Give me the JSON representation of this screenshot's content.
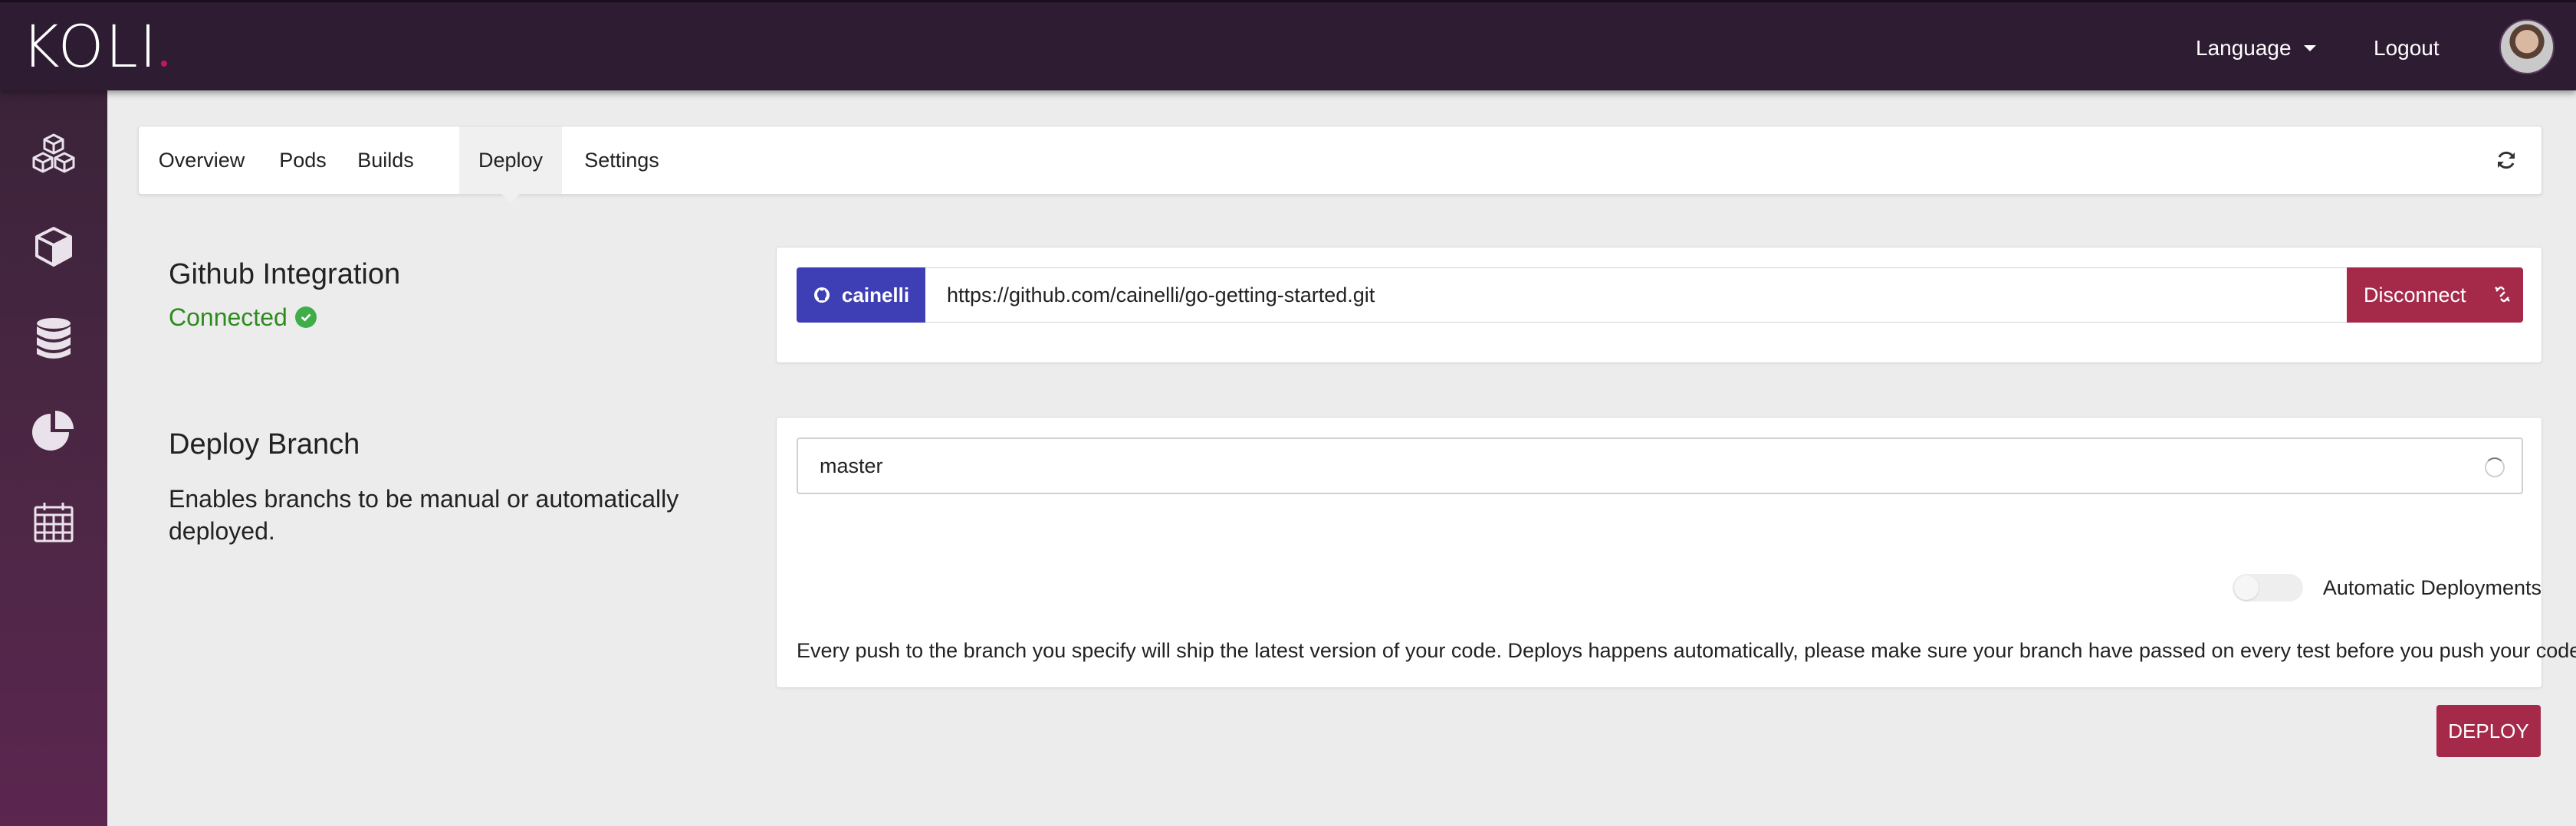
{
  "header": {
    "logo": "KOLI",
    "language_label": "Language",
    "logout_label": "Logout"
  },
  "sidebar": {
    "items": [
      {
        "icon": "cubes-icon"
      },
      {
        "icon": "cube-icon"
      },
      {
        "icon": "database-icon"
      },
      {
        "icon": "pie-chart-icon"
      },
      {
        "icon": "calendar-icon"
      }
    ]
  },
  "tabs": [
    {
      "label": "Overview"
    },
    {
      "label": "Pods"
    },
    {
      "label": "Builds"
    },
    {
      "label": "Deploy",
      "active": true
    },
    {
      "label": "Settings"
    }
  ],
  "github": {
    "title": "Github Integration",
    "status": "Connected",
    "user": "cainelli",
    "repo_url": "https://github.com/cainelli/go-getting-started.git",
    "disconnect_label": "Disconnect"
  },
  "deploy_branch": {
    "title": "Deploy Branch",
    "description": "Enables branchs to be manual or automatically deployed.",
    "branch_value": "master",
    "auto_label": "Automatic Deployments",
    "auto_enabled": false,
    "note": "Every push to the branch you specify will ship the latest version of your code. Deploys happens automatically, please make sure your branch have passed on every test before you push your code.",
    "deploy_label": "DEPLOY"
  },
  "colors": {
    "topbar": "#2e1c32",
    "accent": "#a52a4a",
    "github_badge": "#3f3fb5",
    "success": "#2e8b1e"
  }
}
